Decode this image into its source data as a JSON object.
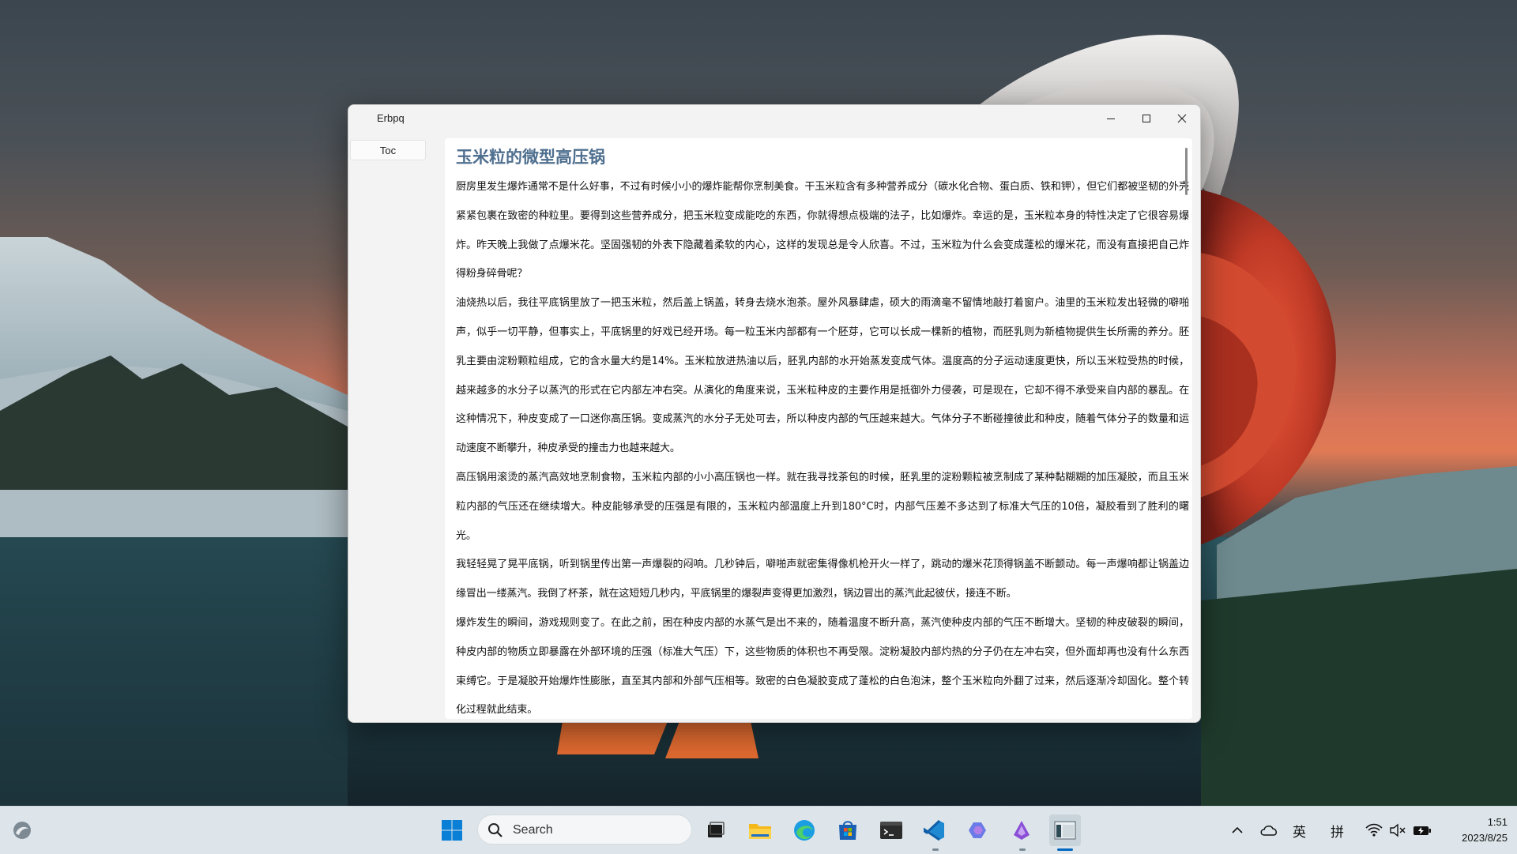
{
  "window": {
    "title": "Erbpq",
    "toc_label": "Toc"
  },
  "article": {
    "title": "玉米粒的微型高压锅",
    "paragraphs": [
      "厨房里发生爆炸通常不是什么好事，不过有时候小小的爆炸能帮你烹制美食。干玉米粒含有多种营养成分（碳水化合物、蛋白质、铁和钾），但它们都被坚韧的外壳紧紧包裹在致密的种粒里。要得到这些营养成分，把玉米粒变成能吃的东西，你就得想点极端的法子，比如爆炸。幸运的是，玉米粒本身的特性决定了它很容易爆炸。昨天晚上我做了点爆米花。坚固强韧的外表下隐藏着柔软的内心，这样的发现总是令人欣喜。不过，玉米粒为什么会变成蓬松的爆米花，而没有直接把自己炸得粉身碎骨呢？",
      "油烧热以后，我往平底锅里放了一把玉米粒，然后盖上锅盖，转身去烧水泡茶。屋外风暴肆虐，硕大的雨滴毫不留情地敲打着窗户。油里的玉米粒发出轻微的噼啪声，似乎一切平静，但事实上，平底锅里的好戏已经开场。每一粒玉米内部都有一个胚芽，它可以长成一棵新的植物，而胚乳则为新植物提供生长所需的养分。胚乳主要由淀粉颗粒组成，它的含水量大约是14%。玉米粒放进热油以后，胚乳内部的水开始蒸发变成气体。温度高的分子运动速度更快，所以玉米粒受热的时候，越来越多的水分子以蒸汽的形式在它内部左冲右突。从演化的角度来说，玉米粒种皮的主要作用是抵御外力侵袭，可是现在，它却不得不承受来自内部的暴乱。在这种情况下，种皮变成了一口迷你高压锅。变成蒸汽的水分子无处可去，所以种皮内部的气压越来越大。气体分子不断碰撞彼此和种皮，随着气体分子的数量和运动速度不断攀升，种皮承受的撞击力也越来越大。",
      "高压锅用滚烫的蒸汽高效地烹制食物，玉米粒内部的小小高压锅也一样。就在我寻找茶包的时候，胚乳里的淀粉颗粒被烹制成了某种黏糊糊的加压凝胶，而且玉米粒内部的气压还在继续增大。种皮能够承受的压强是有限的，玉米粒内部温度上升到180°C时，内部气压差不多达到了标准大气压的10倍，凝胶看到了胜利的曙光。",
      "我轻轻晃了晃平底锅，听到锅里传出第一声爆裂的闷响。几秒钟后，噼啪声就密集得像机枪开火一样了，跳动的爆米花顶得锅盖不断颤动。每一声爆响都让锅盖边缘冒出一缕蒸汽。我倒了杯茶，就在这短短几秒内，平底锅里的爆裂声变得更加激烈，锅边冒出的蒸汽此起彼伏，接连不断。",
      "爆炸发生的瞬间，游戏规则变了。在此之前，困在种皮内部的水蒸气是出不来的，随着温度不断升高，蒸汽使种皮内部的气压不断增大。坚韧的种皮破裂的瞬间，种皮内部的物质立即暴露在外部环境的压强（标准大气压）下，这些物质的体积也不再受限。淀粉凝胶内部灼热的分子仍在左冲右突，但外面却再也没有什么东西束缚它。于是凝胶开始爆炸性膨胀，直至其内部和外部气压相等。致密的白色凝胶变成了蓬松的白色泡沫，整个玉米粒向外翻了过来，然后逐渐冷却固化。整个转化过程就此结束。"
    ]
  },
  "taskbar": {
    "search_label": "Search",
    "apps": [
      "start-icon",
      "task-view-icon",
      "file-explorer-icon",
      "edge-icon",
      "store-icon",
      "terminal-icon",
      "vscode-icon",
      "copilot-icon",
      "visual-studio-icon",
      "app-icon"
    ],
    "tray": {
      "ime_lang": "英",
      "ime_mode": "拼",
      "time": "1:51",
      "date": "2023/8/25"
    }
  },
  "colors": {
    "title_accent": "#4f6f8f",
    "window_bg": "#f3f3f3",
    "taskbar_bg": "#dde5ea",
    "active_indicator": "#0067c0"
  }
}
